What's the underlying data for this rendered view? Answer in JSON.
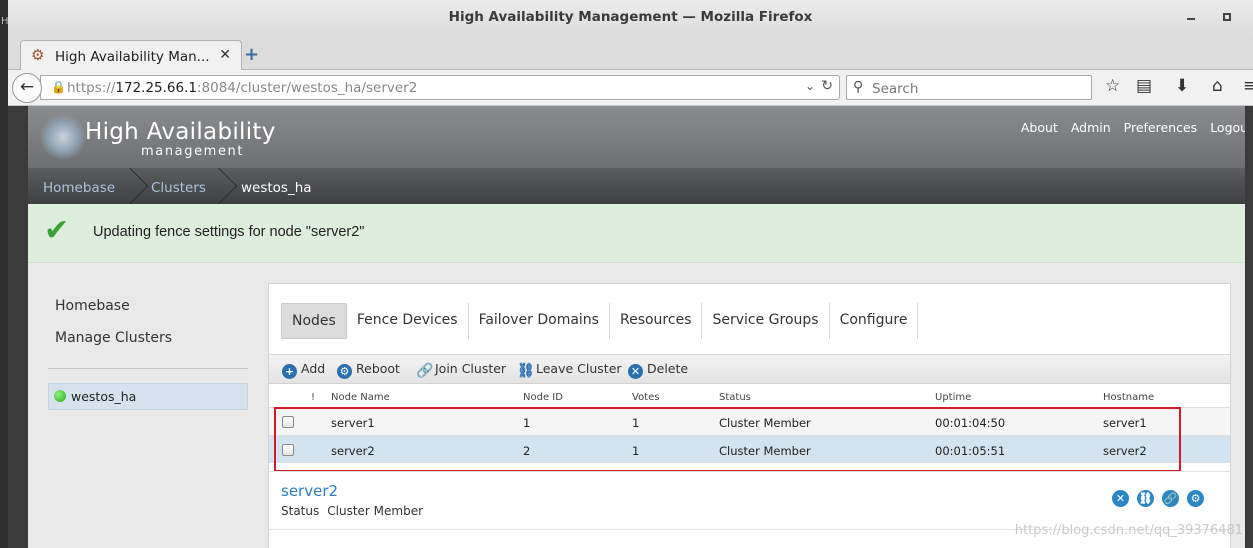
{
  "window": {
    "title": "High Availability Management — Mozilla Firefox",
    "edge_char": "H"
  },
  "browser": {
    "tab_title": "High Availability Man...",
    "url_prefix": "https://",
    "url_host": "172.25.66.1",
    "url_rest": ":8084/cluster/westos_ha/server2",
    "search_placeholder": "Search",
    "icons": [
      "back-arrow-icon",
      "lock-icon",
      "dropdown-icon",
      "reload-icon",
      "search-icon",
      "bookmark-star-icon",
      "reading-list-icon",
      "download-icon",
      "home-icon",
      "menu-icon"
    ]
  },
  "header": {
    "logo_title": "High Availability",
    "logo_subtitle": "management",
    "nav": [
      "About",
      "Admin",
      "Preferences",
      "Logout"
    ]
  },
  "breadcrumb": [
    "Homebase",
    "Clusters",
    "westos_ha"
  ],
  "alert": {
    "message": "Updating fence settings for node \"server2\""
  },
  "sidebar": {
    "items": [
      "Homebase",
      "Manage Clusters"
    ],
    "cluster": "westos_ha",
    "cluster_status_color": "#2bab1a"
  },
  "tabs": [
    "Nodes",
    "Fence Devices",
    "Failover Domains",
    "Resources",
    "Service Groups",
    "Configure"
  ],
  "toolbar": [
    "Add",
    "Reboot",
    "Join Cluster",
    "Leave Cluster",
    "Delete"
  ],
  "table": {
    "headers": [
      "!",
      "Node Name",
      "Node ID",
      "Votes",
      "Status",
      "Uptime",
      "Hostname"
    ],
    "rows": [
      {
        "name": "server1",
        "id": "1",
        "votes": "1",
        "status": "Cluster Member",
        "uptime": "00:01:04:50",
        "hostname": "server1",
        "selected": false
      },
      {
        "name": "server2",
        "id": "2",
        "votes": "1",
        "status": "Cluster Member",
        "uptime": "00:01:05:51",
        "hostname": "server2",
        "selected": true
      }
    ]
  },
  "detail": {
    "name": "server2",
    "status_label": "Status",
    "status_value": "Cluster Member"
  },
  "watermark": "https://blog.csdn.net/qq_39376481",
  "colors": {
    "accent": "#2a6fb0",
    "alert_bg": "#ddeedd",
    "selected_row": "#d3e3ef",
    "highlight_box": "#d41a24"
  }
}
